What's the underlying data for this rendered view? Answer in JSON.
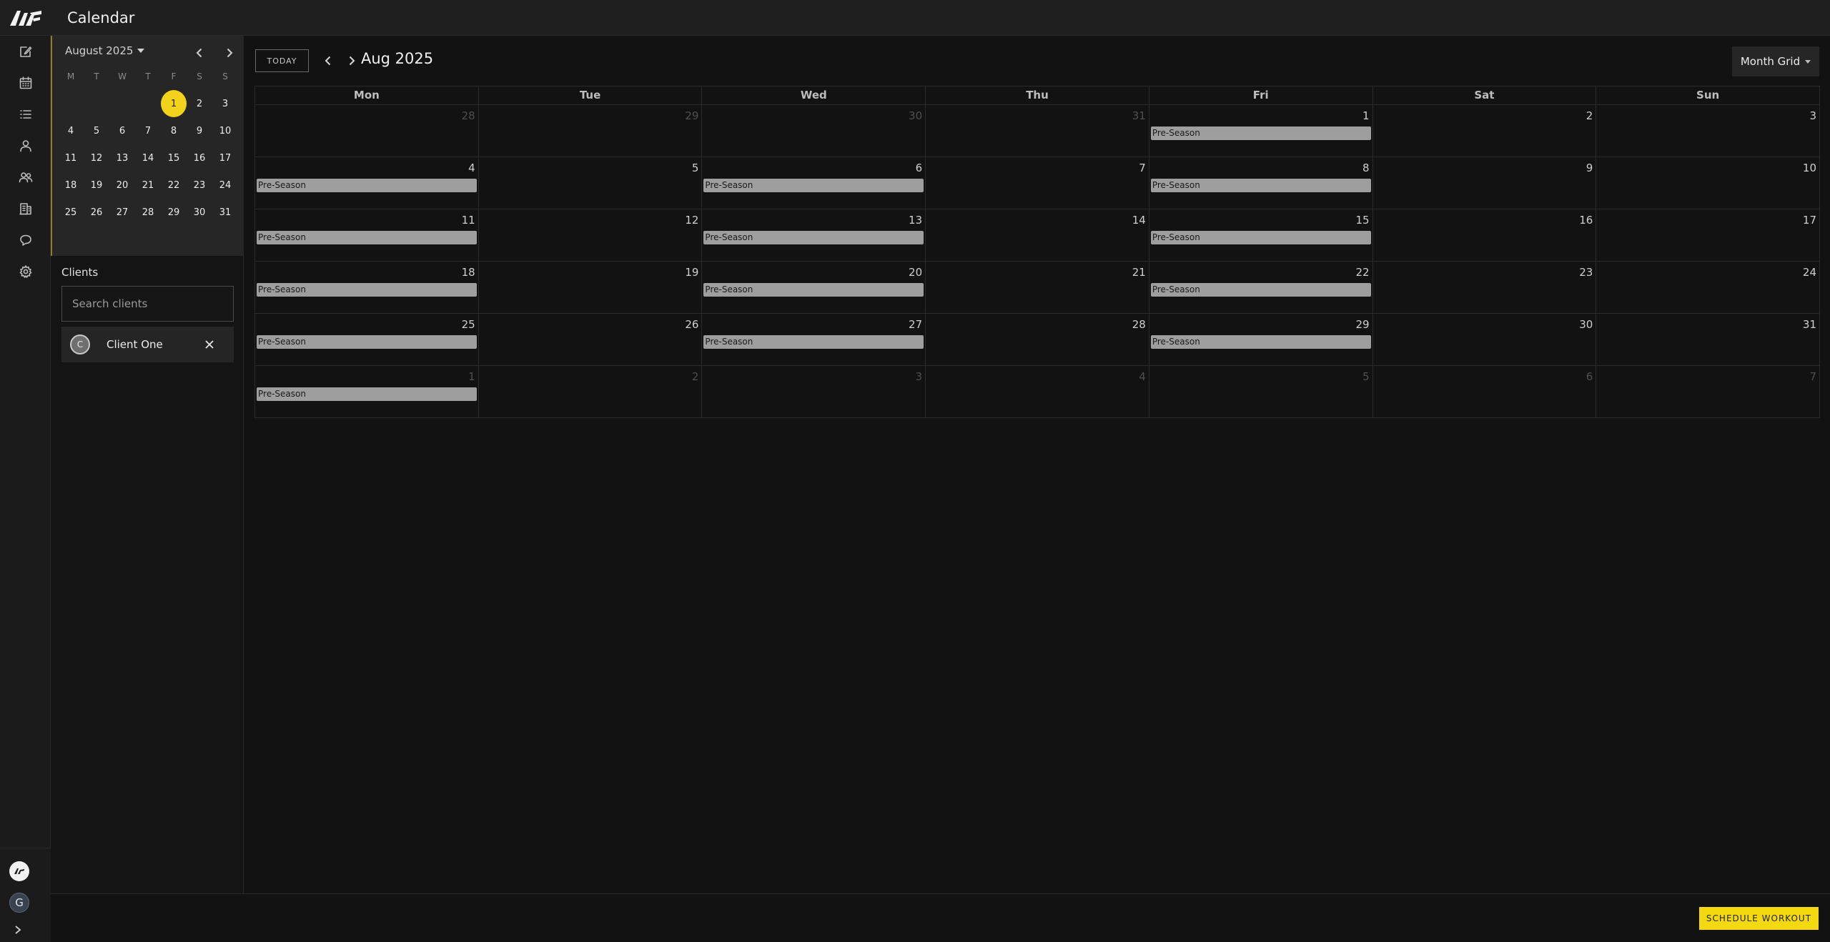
{
  "header": {
    "title": "Calendar"
  },
  "mini_calendar": {
    "month_label": "August 2025",
    "weekday_initials": [
      "M",
      "T",
      "W",
      "T",
      "F",
      "S",
      "S"
    ],
    "leading_blanks": 4,
    "days": [
      1,
      2,
      3,
      4,
      5,
      6,
      7,
      8,
      9,
      10,
      11,
      12,
      13,
      14,
      15,
      16,
      17,
      18,
      19,
      20,
      21,
      22,
      23,
      24,
      25,
      26,
      27,
      28,
      29,
      30,
      31
    ],
    "selected_day": 1
  },
  "clients": {
    "label": "Clients",
    "search_placeholder": "Search clients",
    "items": [
      {
        "initial": "C",
        "name": "Client One"
      }
    ]
  },
  "toolbar": {
    "today_label": "TODAY",
    "period_label": "Aug 2025",
    "view_label": "Month Grid"
  },
  "month_grid": {
    "weekday_labels": [
      "Mon",
      "Tue",
      "Wed",
      "Thu",
      "Fri",
      "Sat",
      "Sun"
    ],
    "weeks": [
      [
        {
          "d": "28",
          "out": true
        },
        {
          "d": "29",
          "out": true
        },
        {
          "d": "30",
          "out": true
        },
        {
          "d": "31",
          "out": true
        },
        {
          "d": "1",
          "event": "Pre-Season"
        },
        {
          "d": "2"
        },
        {
          "d": "3"
        }
      ],
      [
        {
          "d": "4",
          "event": "Pre-Season"
        },
        {
          "d": "5"
        },
        {
          "d": "6",
          "event": "Pre-Season"
        },
        {
          "d": "7"
        },
        {
          "d": "8",
          "event": "Pre-Season"
        },
        {
          "d": "9"
        },
        {
          "d": "10"
        }
      ],
      [
        {
          "d": "11",
          "event": "Pre-Season"
        },
        {
          "d": "12"
        },
        {
          "d": "13",
          "event": "Pre-Season"
        },
        {
          "d": "14"
        },
        {
          "d": "15",
          "event": "Pre-Season"
        },
        {
          "d": "16"
        },
        {
          "d": "17"
        }
      ],
      [
        {
          "d": "18",
          "event": "Pre-Season"
        },
        {
          "d": "19"
        },
        {
          "d": "20",
          "event": "Pre-Season"
        },
        {
          "d": "21"
        },
        {
          "d": "22",
          "event": "Pre-Season"
        },
        {
          "d": "23"
        },
        {
          "d": "24"
        }
      ],
      [
        {
          "d": "25",
          "event": "Pre-Season"
        },
        {
          "d": "26"
        },
        {
          "d": "27",
          "event": "Pre-Season"
        },
        {
          "d": "28"
        },
        {
          "d": "29",
          "event": "Pre-Season"
        },
        {
          "d": "30"
        },
        {
          "d": "31"
        }
      ],
      [
        {
          "d": "1",
          "out": true,
          "event": "Pre-Season"
        },
        {
          "d": "2",
          "out": true
        },
        {
          "d": "3",
          "out": true
        },
        {
          "d": "4",
          "out": true
        },
        {
          "d": "5",
          "out": true
        },
        {
          "d": "6",
          "out": true
        },
        {
          "d": "7",
          "out": true
        }
      ]
    ]
  },
  "footer": {
    "schedule_label": "SCHEDULE WORKOUT"
  },
  "user": {
    "initial": "G"
  },
  "nav_icons": [
    "edit-icon",
    "calendar-icon",
    "list-icon",
    "person-icon",
    "group-icon",
    "building-icon",
    "chat-icon",
    "gear-icon"
  ],
  "colors": {
    "accent": "#f5d90f",
    "event": "#9e9e9e",
    "background": "#121212"
  }
}
